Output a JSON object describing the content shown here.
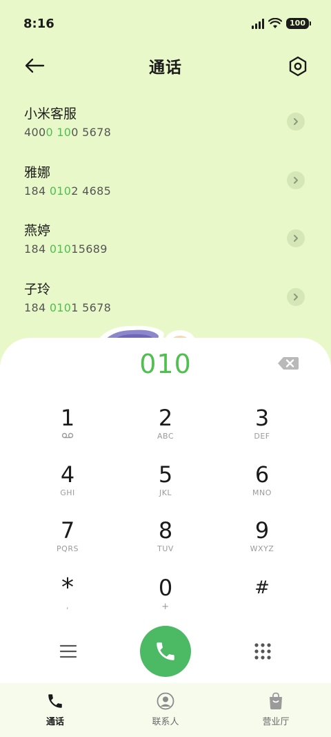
{
  "status": {
    "time": "8:16",
    "battery": "100"
  },
  "header": {
    "title": "通话"
  },
  "results": [
    {
      "name": "小米客服",
      "pre": "400",
      "match1": "0",
      "mid": " ",
      "match2": "10",
      "post": "0 5678"
    },
    {
      "name": "雅娜",
      "pre": "184 ",
      "match1": "010",
      "mid": "",
      "match2": "",
      "post": "2 4685"
    },
    {
      "name": "燕婷",
      "pre": "184 ",
      "match1": "010",
      "mid": "",
      "match2": "",
      "post": "15689"
    },
    {
      "name": "子玲",
      "pre": "184 ",
      "match1": "010",
      "mid": "",
      "match2": "",
      "post": "1 5678"
    }
  ],
  "dialer": {
    "input": "010",
    "keys": [
      {
        "digit": "1",
        "sub": ""
      },
      {
        "digit": "2",
        "sub": "ABC"
      },
      {
        "digit": "3",
        "sub": "DEF"
      },
      {
        "digit": "4",
        "sub": "GHI"
      },
      {
        "digit": "5",
        "sub": "JKL"
      },
      {
        "digit": "6",
        "sub": "MNO"
      },
      {
        "digit": "7",
        "sub": "PQRS"
      },
      {
        "digit": "8",
        "sub": "TUV"
      },
      {
        "digit": "9",
        "sub": "WXYZ"
      },
      {
        "digit": "*",
        "sub": ","
      },
      {
        "digit": "0",
        "sub": "+"
      },
      {
        "digit": "#",
        "sub": ""
      }
    ]
  },
  "nav": [
    {
      "label": "通话",
      "icon": "phone-icon"
    },
    {
      "label": "联系人",
      "icon": "person-icon"
    },
    {
      "label": "营业厅",
      "icon": "bag-icon"
    }
  ],
  "colors": {
    "accent": "#4fbf4f",
    "call": "#4cb964",
    "background": "#e9f8c9"
  }
}
